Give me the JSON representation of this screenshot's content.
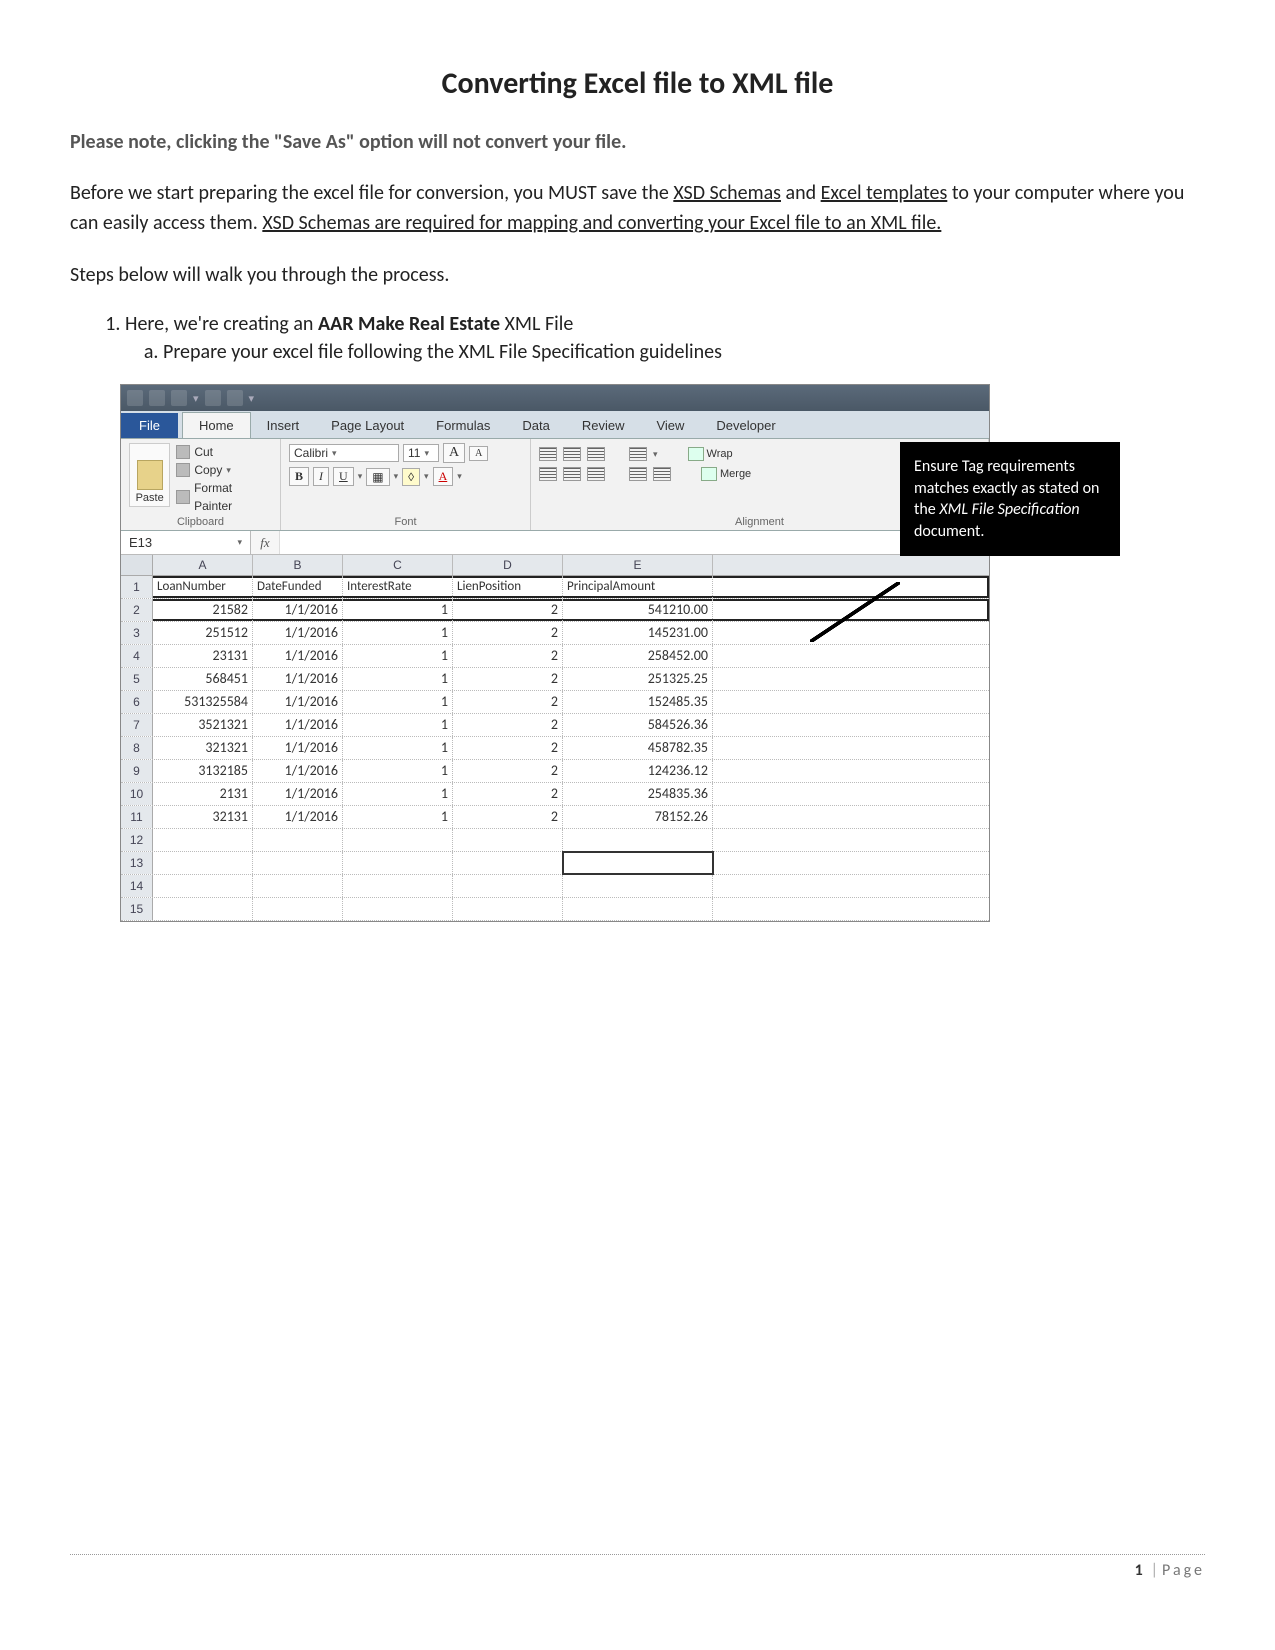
{
  "doc": {
    "title": "Converting Excel file to XML file",
    "note": "Please note, clicking the \"Save As\" option will not convert your file.",
    "para1_pre": "Before we start preparing the excel file for conversion, you MUST save the ",
    "link_xsd": "XSD Schemas",
    "para1_mid": " and ",
    "link_tpl": "Excel templates",
    "para1_post": " to your computer where you can easily access them. ",
    "link_req": "XSD Schemas are required for mapping and converting your Excel file to an XML file.",
    "para2": "Steps below will walk you through the process.",
    "step1_pre": "Here, we're creating an ",
    "step1_bold": "AAR Make Real Estate",
    "step1_post": " XML File",
    "step1a": "Prepare your excel file following the XML File Specification guidelines"
  },
  "ribbon": {
    "file": "File",
    "tabs": [
      "Home",
      "Insert",
      "Page Layout",
      "Formulas",
      "Data",
      "Review",
      "View",
      "Developer"
    ],
    "clipboard": {
      "paste": "Paste",
      "cut": "Cut",
      "copy": "Copy",
      "fmt": "Format Painter",
      "label": "Clipboard"
    },
    "font": {
      "name": "Calibri",
      "size": "11",
      "label": "Font",
      "bold": "B",
      "italic": "I",
      "underline": "U",
      "grow": "A",
      "shrink": "A"
    },
    "align": {
      "label": "Alignment",
      "wrap": "Wrap",
      "merge": "Merge"
    },
    "namebox": "E13",
    "fx": "fx"
  },
  "sheet": {
    "cols": [
      "A",
      "B",
      "C",
      "D",
      "E"
    ],
    "headers": [
      "LoanNumber",
      "DateFunded",
      "InterestRate",
      "LienPosition",
      "PrincipalAmount"
    ],
    "rows": [
      {
        "n": "21582",
        "d": "1/1/2016",
        "i": "1",
        "l": "2",
        "p": "541210.00"
      },
      {
        "n": "251512",
        "d": "1/1/2016",
        "i": "1",
        "l": "2",
        "p": "145231.00"
      },
      {
        "n": "23131",
        "d": "1/1/2016",
        "i": "1",
        "l": "2",
        "p": "258452.00"
      },
      {
        "n": "568451",
        "d": "1/1/2016",
        "i": "1",
        "l": "2",
        "p": "251325.25"
      },
      {
        "n": "531325584",
        "d": "1/1/2016",
        "i": "1",
        "l": "2",
        "p": "152485.35"
      },
      {
        "n": "3521321",
        "d": "1/1/2016",
        "i": "1",
        "l": "2",
        "p": "584526.36"
      },
      {
        "n": "321321",
        "d": "1/1/2016",
        "i": "1",
        "l": "2",
        "p": "458782.35"
      },
      {
        "n": "3132185",
        "d": "1/1/2016",
        "i": "1",
        "l": "2",
        "p": "124236.12"
      },
      {
        "n": "2131",
        "d": "1/1/2016",
        "i": "1",
        "l": "2",
        "p": "254835.36"
      },
      {
        "n": "32131",
        "d": "1/1/2016",
        "i": "1",
        "l": "2",
        "p": "78152.26"
      }
    ],
    "empty_rows": [
      "12",
      "13",
      "14",
      "15"
    ]
  },
  "callout": {
    "l1": "Ensure Tag requirements matches exactly as stated on the ",
    "l2": "XML File Specification",
    "l3": " document."
  },
  "footer": {
    "page": "1",
    "label": "Page"
  }
}
